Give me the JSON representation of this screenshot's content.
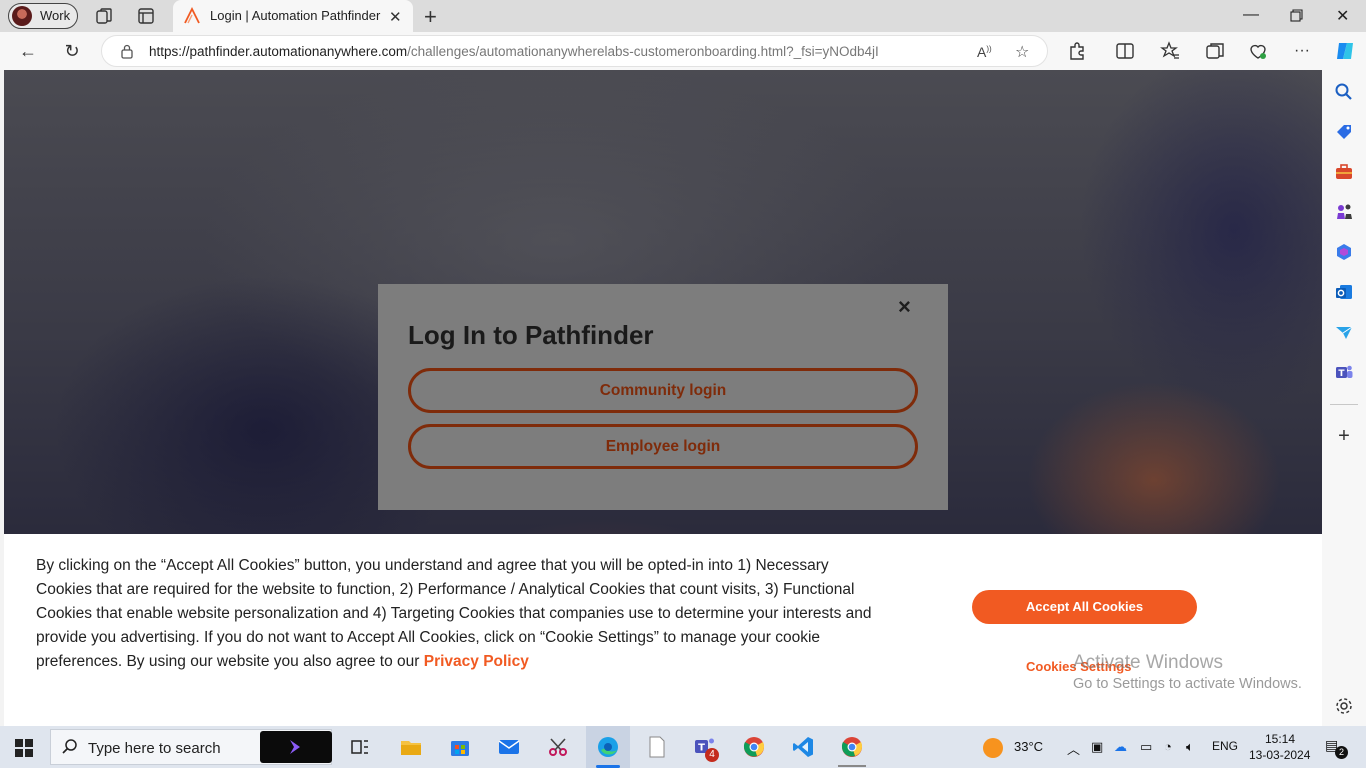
{
  "browser": {
    "profile_name": "Work",
    "tab_title": "Login | Automation Pathfinder | A",
    "url_host": "https://pathfinder.automationanywhere.com",
    "url_path": "/challenges/automationanywherelabs-customeronboarding.html?_fsi=yNOdb4jI"
  },
  "modal": {
    "title": "Log In to Pathfinder",
    "community_login": "Community login",
    "employee_login": "Employee login",
    "close_glyph": "×"
  },
  "cookie_banner": {
    "text": "By clicking on the “Accept All Cookies” button, you understand and agree that you will be opted-in into 1) Necessary Cookies that are required for the website to function, 2) Performance / Analytical Cookies that count visits, 3) Functional Cookies that enable website personalization and 4) Targeting Cookies that companies use to determine your interests and provide you advertising. If you do not want to Accept All Cookies, click on “Cookie Settings” to manage your cookie preferences. By using our website you also agree to our ",
    "privacy_link": "Privacy Policy",
    "accept_label": "Accept All Cookies",
    "settings_label": "Cookies Settings"
  },
  "watermark": {
    "line1": "Activate Windows",
    "line2": "Go to Settings to activate Windows."
  },
  "taskbar": {
    "search_placeholder": "Type here to search",
    "weather": "33°C",
    "language": "ENG",
    "time": "15:14",
    "date": "13-03-2024",
    "notification_count": "2",
    "teams_badge": "4"
  },
  "colors": {
    "accent_orange": "#f15a22",
    "modal_button_border": "#7f2b0a"
  }
}
